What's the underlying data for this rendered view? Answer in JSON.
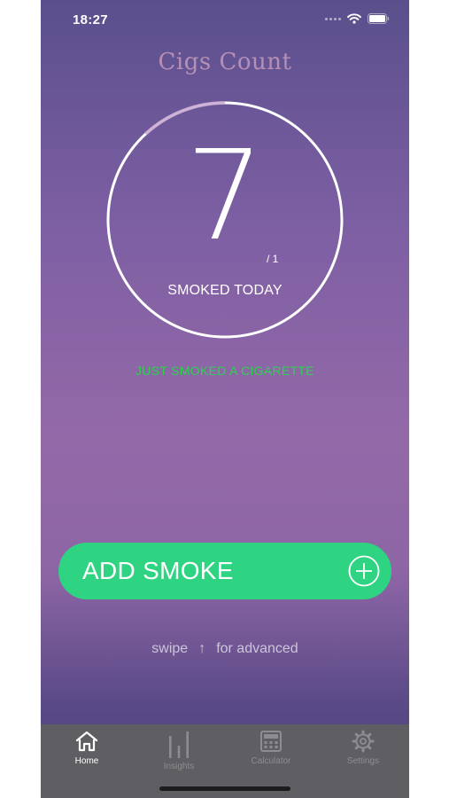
{
  "status_bar": {
    "time": "18:27",
    "icons": [
      "cellular-signal-icon",
      "wifi-icon",
      "battery-icon"
    ]
  },
  "app": {
    "title": "Cigs Count"
  },
  "counter": {
    "count": "7",
    "goal": "/ 1",
    "label": "SMOKED TODAY"
  },
  "status_message": "JUST SMOKED A CIGARETTE",
  "add_button": {
    "label": "ADD SMOKE",
    "icon": "plus-circle-icon"
  },
  "swipe_hint": {
    "prefix": "swipe",
    "arrow": "↑",
    "suffix": "for advanced"
  },
  "tab_bar": {
    "tabs": [
      {
        "label": "Home",
        "icon": "home-icon",
        "active": true
      },
      {
        "label": "Insights",
        "icon": "bar-chart-icon",
        "active": false
      },
      {
        "label": "Calculator",
        "icon": "calculator-icon",
        "active": false
      },
      {
        "label": "Settings",
        "icon": "gear-icon",
        "active": false
      }
    ]
  },
  "colors": {
    "accent_green": "#2fd483",
    "message_green": "#2dd24e",
    "title_pink": "#b68fb6",
    "tab_bar_bg": "#5f5f63"
  }
}
